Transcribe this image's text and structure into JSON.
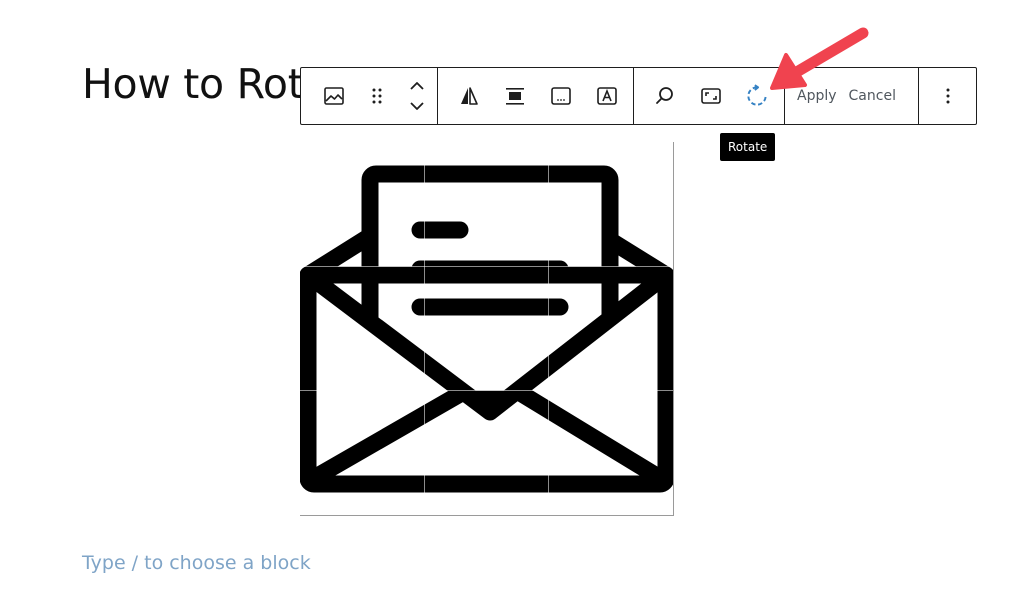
{
  "post": {
    "title": "How to Rotate an Image in WordPress"
  },
  "toolbar": {
    "groups": [
      {
        "items": [
          {
            "icon": "image-icon",
            "label": "Image"
          },
          {
            "icon": "drag-handle-icon",
            "label": "Drag"
          },
          {
            "icon": "move-up-down-icon",
            "label": "Move up/down"
          }
        ]
      },
      {
        "items": [
          {
            "icon": "align-left-triangle-icon",
            "label": "Align"
          },
          {
            "icon": "align-center-icon",
            "label": "Change alignment"
          },
          {
            "icon": "caption-icon",
            "label": "Caption"
          },
          {
            "icon": "text-overlay-icon",
            "label": "Text over image"
          }
        ]
      },
      {
        "items": [
          {
            "icon": "zoom-search-icon",
            "label": "Zoom"
          },
          {
            "icon": "aspect-ratio-icon",
            "label": "Aspect Ratio"
          },
          {
            "icon": "rotate-icon",
            "label": "Rotate"
          }
        ]
      }
    ],
    "apply_label": "Apply",
    "cancel_label": "Cancel",
    "more_icon": "more-vertical-icon"
  },
  "tooltip": {
    "text": "Rotate"
  },
  "image": {
    "icon": "open-envelope-letter-icon"
  },
  "editor": {
    "placeholder": "Type / to choose a block"
  },
  "colors": {
    "accent": "#3582c4",
    "arrow": "#f0434f",
    "placeholder_text": "#7fa4c7",
    "toolbar_border": "#1e1e1e"
  }
}
